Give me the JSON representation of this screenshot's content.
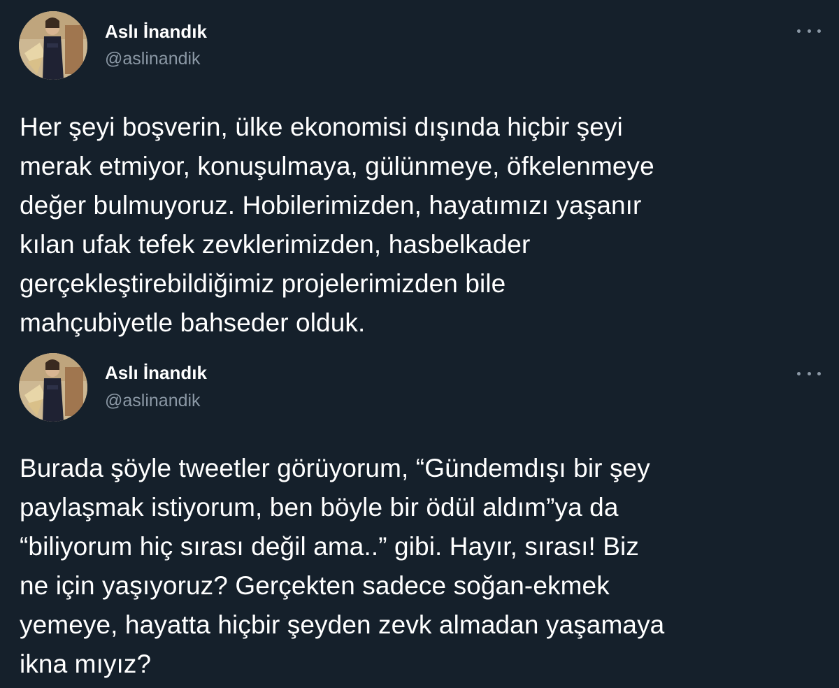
{
  "tweets": [
    {
      "author": {
        "name": "Aslı İnandık",
        "handle": "@aslinandik"
      },
      "more_icon": "more-horizontal-icon",
      "text": "Her şeyi boşverin, ülke ekonomisi dışında hiçbir şeyi\nmerak etmiyor, konuşulmaya, gülünmeye, öfkelenmeye\ndeğer bulmuyoruz. Hobilerimizden, hayatımızı yaşanır\nkılan ufak tefek zevklerimizden, hasbelkader\ngerçekleştirebildiğimiz projelerimizden bile\nmahçubiyetle bahseder olduk."
    },
    {
      "author": {
        "name": "Aslı İnandık",
        "handle": "@aslinandik"
      },
      "more_icon": "more-horizontal-icon",
      "text": "Burada şöyle tweetler görüyorum, “Gündemdışı bir şey\npaylaşmak istiyorum, ben böyle bir ödül aldım”ya da\n“biliyorum hiç sırası değil ama..” gibi. Hayır, sırası! Biz\nne için yaşıyoruz? Gerçekten sadece soğan-ekmek\nyemeye, hayatta hiçbir şeyden zevk almadan yaşamaya\nikna mıyız?"
    }
  ],
  "colors": {
    "background": "#15202b",
    "primary_text": "#ffffff",
    "secondary_text": "#8b98a5"
  }
}
